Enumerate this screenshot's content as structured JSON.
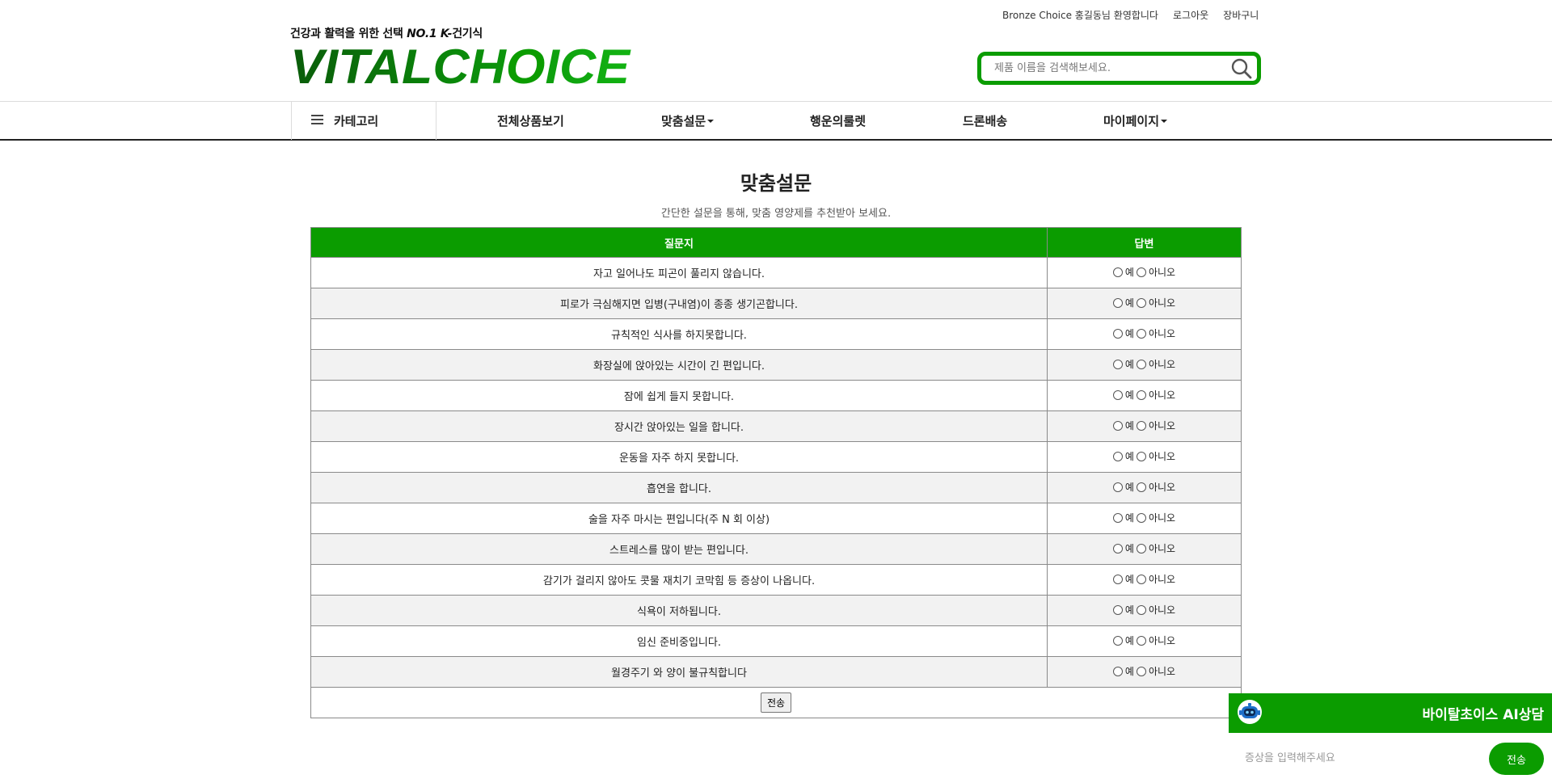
{
  "header": {
    "welcome_text": "Bronze Choice 홍길동님 환영합니다",
    "logout_label": "로그아웃",
    "cart_label": "장바구니",
    "tagline_prefix": "건강과 활력을 위한 선택",
    "tagline_highlight": "NO.1 K-",
    "tagline_suffix": "건기식",
    "logo_text": "VITALCHOICE"
  },
  "search": {
    "placeholder": "제품 이름을 검색해보세요."
  },
  "nav": {
    "category_label": "카테고리",
    "items": [
      {
        "label": "전체상품보기"
      },
      {
        "label": "맞춤설문"
      },
      {
        "label": "행운의룰렛"
      },
      {
        "label": "드론배송"
      },
      {
        "label": "마이페이지"
      }
    ]
  },
  "survey": {
    "title": "맞춤설문",
    "subtitle": "간단한 설문을 통해, 맞춤 영양제를 추천받아 보세요.",
    "col_question": "질문지",
    "col_answer": "답변",
    "yes_label": "예",
    "no_label": "아니오",
    "submit_label": "전송",
    "questions": [
      "자고 일어나도 피곤이 풀리지 않습니다.",
      "피로가 극심해지면 입병(구내염)이 종종 생기곤합니다.",
      "규칙적인 식사를 하지못합니다.",
      "화장실에 앉아있는 시간이 긴 편입니다.",
      "잠에 쉽게 들지 못합니다.",
      "장시간 앉아있는 일을 합니다.",
      "운동을 자주 하지 못합니다.",
      "흡연을 합니다.",
      "술을 자주 마시는 편입니다(주 N 회 이상)",
      "스트레스를 많이 받는 편입니다.",
      "감기가 걸리지 않아도 콧물 재치기 코막힘 등 증상이 나옵니다.",
      "식욕이 저하됩니다.",
      "임신 준비중입니다.",
      "월경주기 와 양이 불규칙합니다"
    ]
  },
  "chat": {
    "title": "바이탈초이스 AI상담",
    "placeholder": "증상을 입력해주세요",
    "send_label": "전송"
  },
  "colors": {
    "brand_green": "#0b9c00",
    "logo_dark_green": "#0a6a0a",
    "row_alt": "#f2f2f2"
  },
  "icons": {
    "menu": "hamburger-icon",
    "search": "search-icon",
    "chatbot": "robot-icon"
  }
}
